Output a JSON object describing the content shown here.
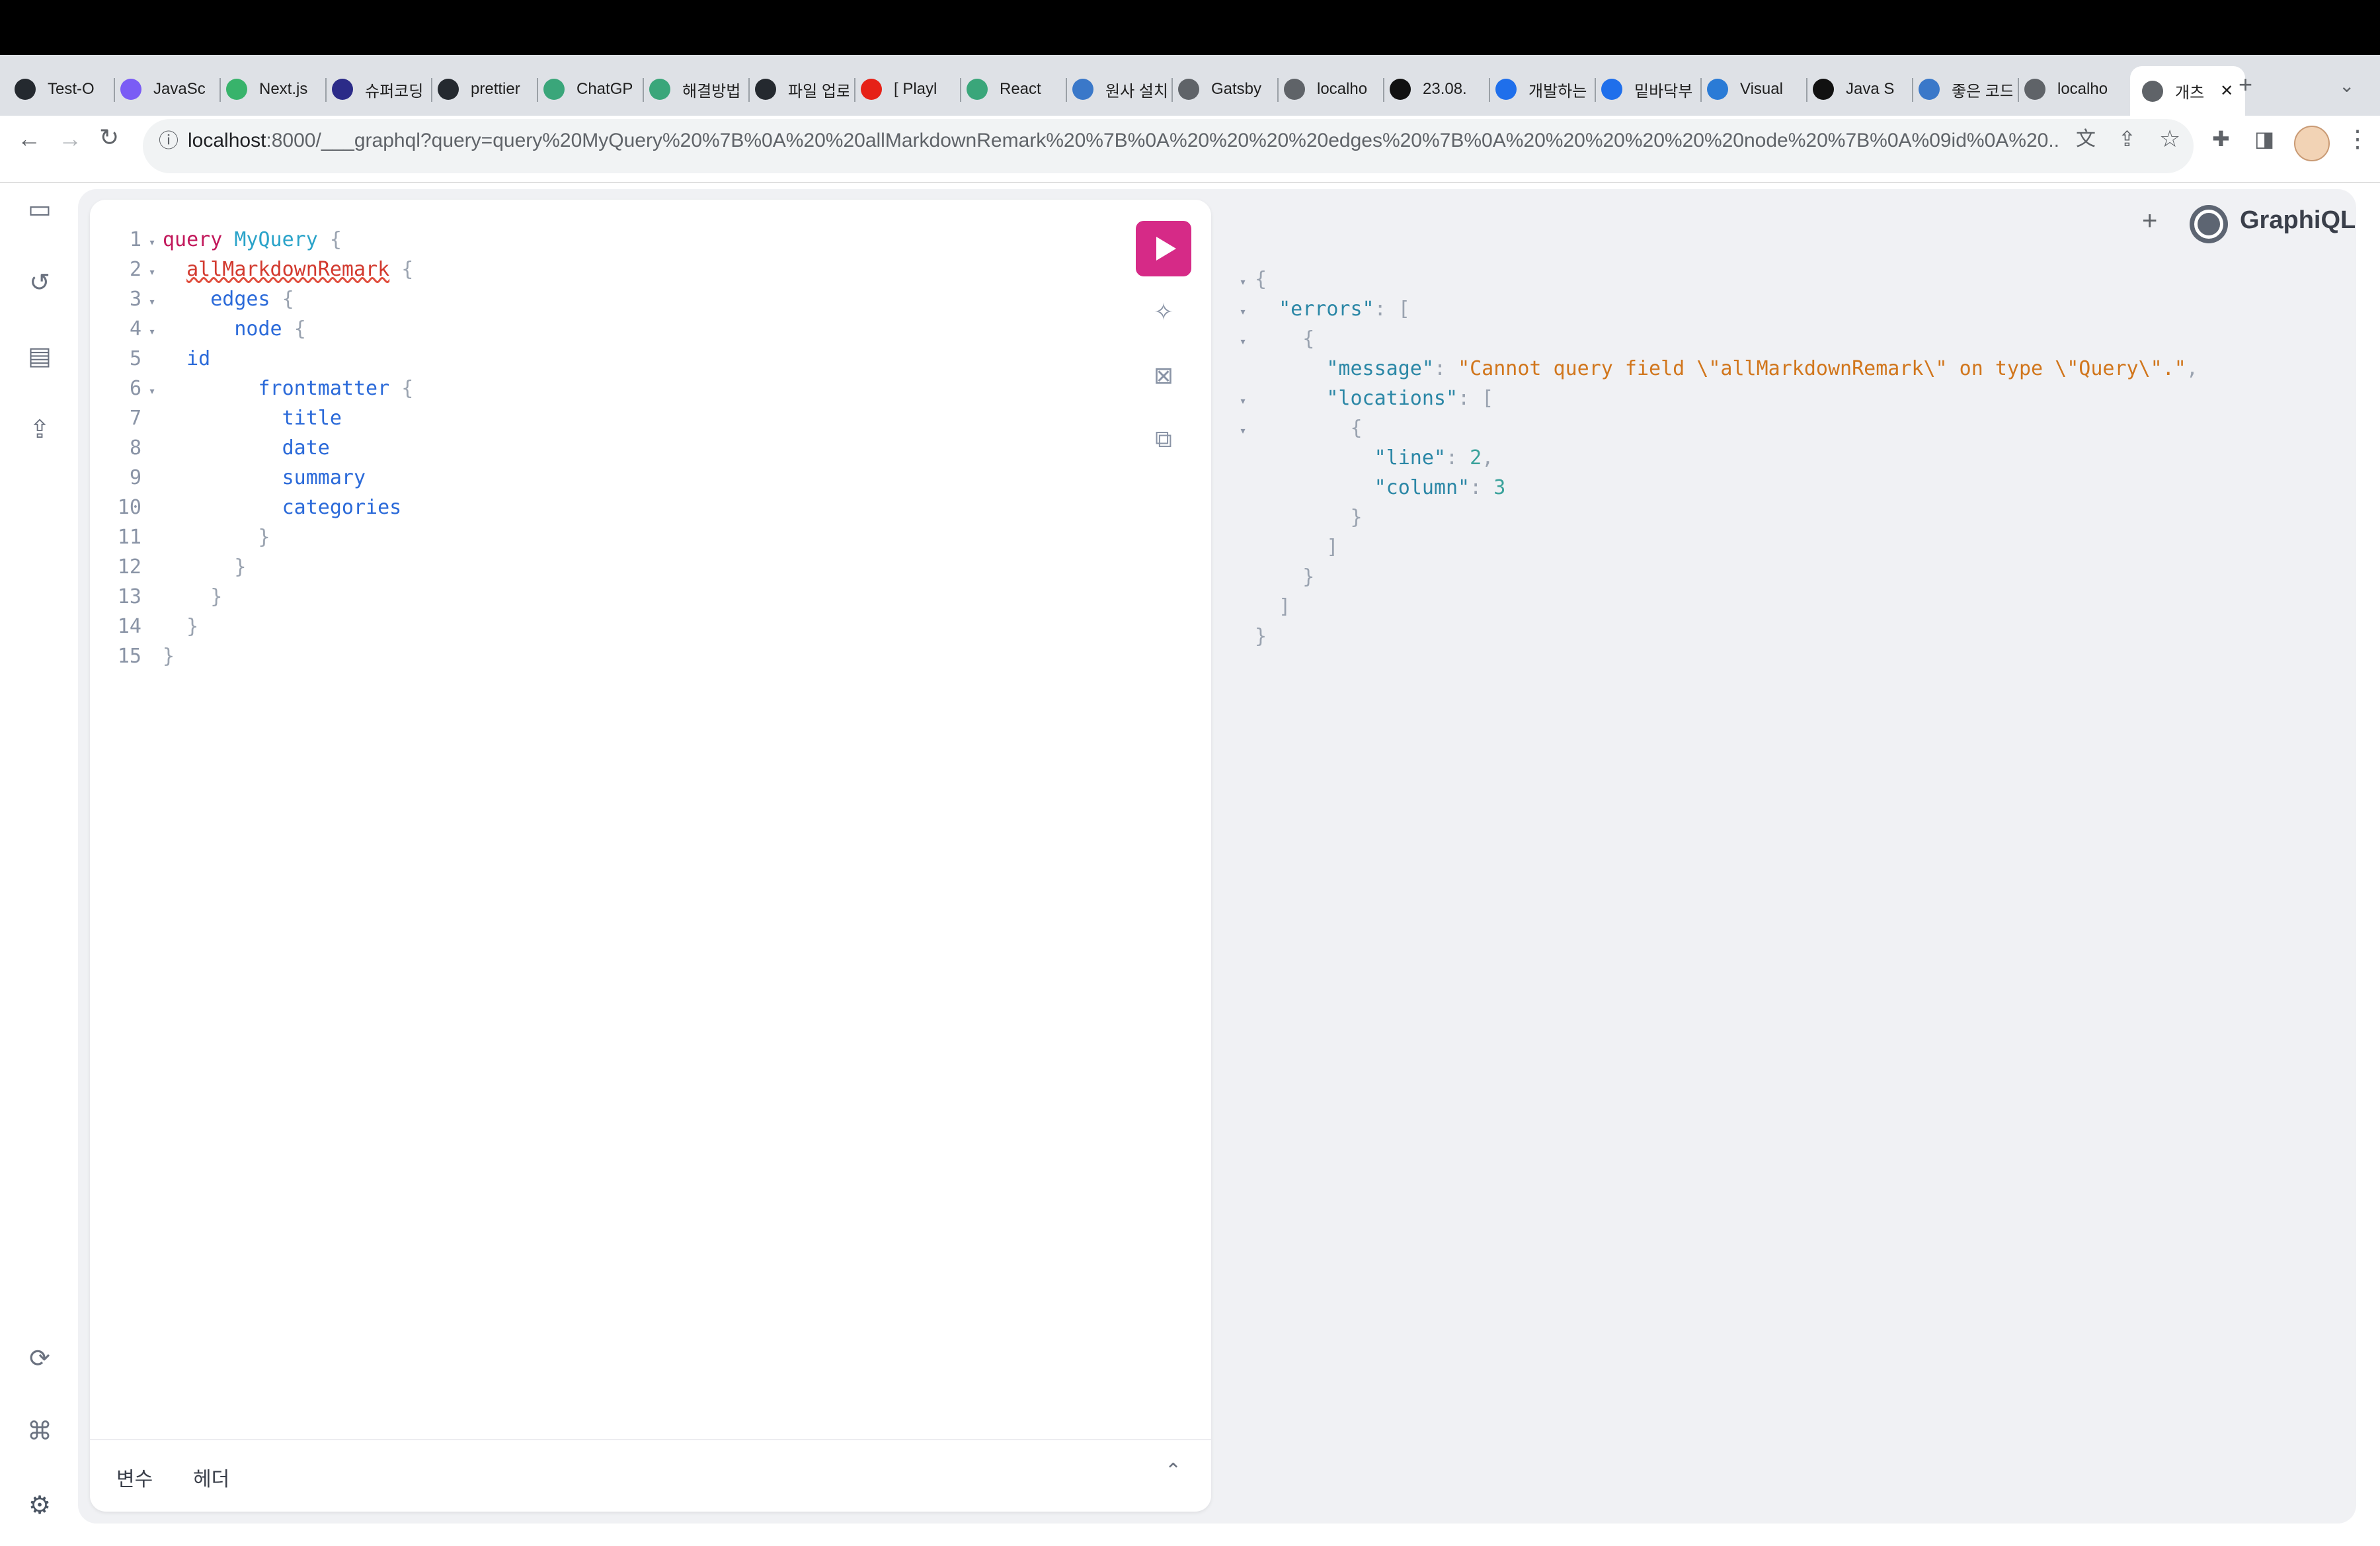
{
  "browser": {
    "tabs": [
      {
        "label": "Test-O",
        "color": "#24292f",
        "icon": "github-icon"
      },
      {
        "label": "JavaSc",
        "color": "#7a5cf5",
        "icon": "vite-icon"
      },
      {
        "label": "Next.js",
        "color": "#38b36b",
        "icon": "v-icon"
      },
      {
        "label": "슈퍼코딩",
        "color": "#2b2b88",
        "icon": "diamond-icon"
      },
      {
        "label": "prettier",
        "color": "#24292f",
        "icon": "github-icon"
      },
      {
        "label": "ChatGP",
        "color": "#3aa67a",
        "icon": "chatgpt-icon"
      },
      {
        "label": "해결방법",
        "color": "#3aa67a",
        "icon": "chatgpt-icon"
      },
      {
        "label": "파일 업로",
        "color": "#24292f",
        "icon": "github-icon"
      },
      {
        "label": "[ Playl",
        "color": "#e62117",
        "icon": "youtube-icon"
      },
      {
        "label": "React",
        "color": "#3aa67a",
        "icon": "r-icon"
      },
      {
        "label": "원사 설치",
        "color": "#3a78c9",
        "icon": "person-icon"
      },
      {
        "label": "Gatsby",
        "color": "#5f6368",
        "icon": "globe-icon"
      },
      {
        "label": "localho",
        "color": "#5f6368",
        "icon": "globe-icon"
      },
      {
        "label": "23.08.",
        "color": "#111111",
        "icon": "notion-icon"
      },
      {
        "label": "개발하는",
        "color": "#1f6feb",
        "icon": "y-icon"
      },
      {
        "label": "밑바닥부",
        "color": "#1f6feb",
        "icon": "y-icon"
      },
      {
        "label": "Visual",
        "color": "#2a7bd6",
        "icon": "vscode-icon"
      },
      {
        "label": "Java S",
        "color": "#111111",
        "icon": "medium-icon"
      },
      {
        "label": "좋은 코드",
        "color": "#3a78c9",
        "icon": "wordpress-icon"
      },
      {
        "label": "localho",
        "color": "#5f6368",
        "icon": "globe-icon"
      },
      {
        "label": "개츠",
        "color": "#5f6368",
        "icon": "globe-icon"
      }
    ],
    "new_tab": "+",
    "url_host": "localhost",
    "url_rest": ":8000/___graphql?query=query%20MyQuery%20%7B%0A%20%20allMarkdownRemark%20%7B%0A%20%20%20%20edges%20%7B%0A%20%20%20%20%20%20node%20%7B%0A%09id%0A%20..."
  },
  "editor": {
    "lines": [
      {
        "n": "1",
        "fold": "▾"
      },
      {
        "n": "2",
        "fold": "▾"
      },
      {
        "n": "3",
        "fold": "▾"
      },
      {
        "n": "4",
        "fold": "▾"
      },
      {
        "n": "5",
        "fold": ""
      },
      {
        "n": "6",
        "fold": "▾"
      },
      {
        "n": "7",
        "fold": ""
      },
      {
        "n": "8",
        "fold": ""
      },
      {
        "n": "9",
        "fold": ""
      },
      {
        "n": "10",
        "fold": ""
      },
      {
        "n": "11",
        "fold": ""
      },
      {
        "n": "12",
        "fold": ""
      },
      {
        "n": "13",
        "fold": ""
      },
      {
        "n": "14",
        "fold": ""
      },
      {
        "n": "15",
        "fold": ""
      }
    ],
    "kw_query": "query",
    "query_name": "MyQuery",
    "field_root": "allMarkdownRemark",
    "field_edges": "edges",
    "field_node": "node",
    "field_id": "id",
    "field_frontmatter": "frontmatter",
    "field_title": "title",
    "field_date": "date",
    "field_summary": "summary",
    "field_categories": "categories",
    "open_brace": "{",
    "close_brace": "}",
    "bottom_tabs": {
      "variables": "변수",
      "headers": "헤더"
    }
  },
  "result": {
    "key_errors": "\"errors\"",
    "key_message": "\"message\"",
    "message_value": "\"Cannot query field \\\"allMarkdownRemark\\\" on type \\\"Query\\\".\"",
    "key_locations": "\"locations\"",
    "key_line": "\"line\"",
    "val_line": "2",
    "key_column": "\"column\"",
    "val_column": "3"
  },
  "header": {
    "brand": "GraphiQL",
    "add": "+"
  }
}
